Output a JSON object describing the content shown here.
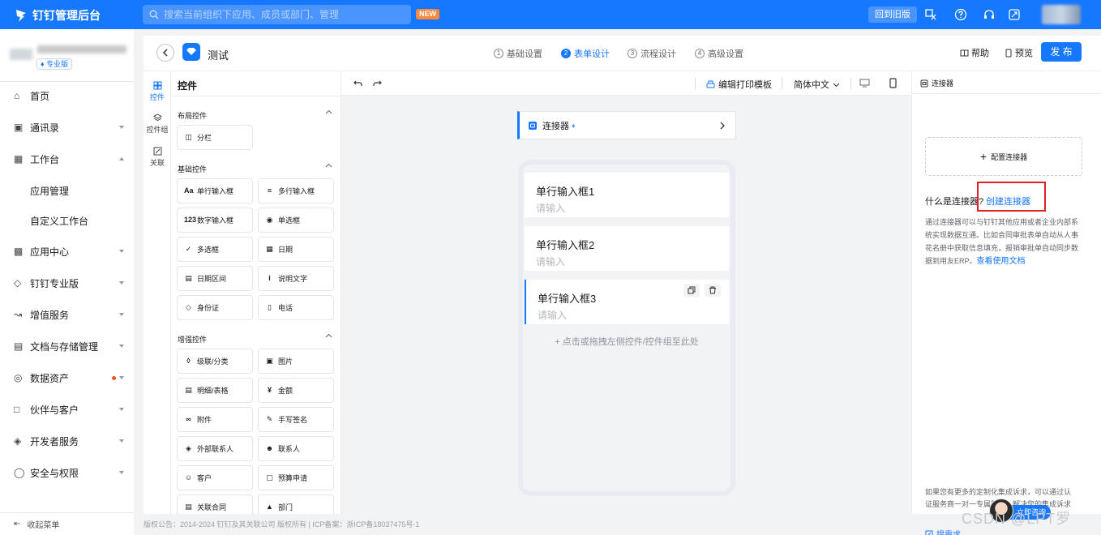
{
  "topbar": {
    "brand": "钉钉管理后台",
    "search_placeholder": "搜索当前组织下应用、成员或部门、管理",
    "new_badge": "NEW",
    "old_version": "回到旧版"
  },
  "sidebar": {
    "plan_badge": "专业版",
    "items": [
      {
        "label": "首页",
        "icon": "home-icon",
        "arrow": ""
      },
      {
        "label": "通讯录",
        "icon": "contacts-icon",
        "arrow": "down"
      },
      {
        "label": "工作台",
        "icon": "workbench-icon",
        "arrow": "up"
      },
      {
        "label": "应用管理",
        "icon": "",
        "arrow": ""
      },
      {
        "label": "自定义工作台",
        "icon": "",
        "arrow": ""
      },
      {
        "label": "应用中心",
        "icon": "app-center-icon",
        "arrow": "down"
      },
      {
        "label": "钉钉专业版",
        "icon": "diamond-icon",
        "arrow": "down"
      },
      {
        "label": "增值服务",
        "icon": "chart-icon",
        "arrow": "down"
      },
      {
        "label": "文档与存储管理",
        "icon": "storage-icon",
        "arrow": "down"
      },
      {
        "label": "数据资产",
        "icon": "data-icon",
        "arrow": "down"
      },
      {
        "label": "伙伴与客户",
        "icon": "partner-icon",
        "arrow": "down"
      },
      {
        "label": "开发者服务",
        "icon": "layers-icon",
        "arrow": "down"
      },
      {
        "label": "安全与权限",
        "icon": "shield-icon",
        "arrow": "down"
      }
    ],
    "collapse": "收起菜单"
  },
  "header": {
    "title": "测试",
    "steps": [
      {
        "num": "1",
        "label": "基础设置",
        "active": false
      },
      {
        "num": "2",
        "label": "表单设计",
        "active": true
      },
      {
        "num": "3",
        "label": "流程设计",
        "active": false
      },
      {
        "num": "4",
        "label": "高级设置",
        "active": false
      }
    ],
    "help": "帮助",
    "preview": "预览",
    "publish": "发 布"
  },
  "tabs": [
    {
      "label": "控件"
    },
    {
      "label": "控件组"
    },
    {
      "label": "关联"
    }
  ],
  "controls": {
    "title": "控件",
    "groups": [
      {
        "title": "布局控件",
        "items": [
          {
            "label": "分栏",
            "icon": "columns-icon"
          }
        ]
      },
      {
        "title": "基础控件",
        "items": [
          {
            "label": "单行输入框",
            "icon": "text-input-icon"
          },
          {
            "label": "多行输入框",
            "icon": "textarea-icon"
          },
          {
            "label": "数字输入框",
            "icon": "number-icon"
          },
          {
            "label": "单选框",
            "icon": "radio-icon"
          },
          {
            "label": "多选框",
            "icon": "checkbox-icon"
          },
          {
            "label": "日期",
            "icon": "date-icon"
          },
          {
            "label": "日期区间",
            "icon": "date-range-icon"
          },
          {
            "label": "说明文字",
            "icon": "info-icon"
          },
          {
            "label": "身份证",
            "icon": "id-card-icon"
          },
          {
            "label": "电话",
            "icon": "phone-icon"
          }
        ]
      },
      {
        "title": "增强控件",
        "items": [
          {
            "label": "级联/分类",
            "icon": "cascade-icon"
          },
          {
            "label": "图片",
            "icon": "image-icon"
          },
          {
            "label": "明细/表格",
            "icon": "table-icon"
          },
          {
            "label": "金额",
            "icon": "money-icon"
          },
          {
            "label": "附件",
            "icon": "attachment-icon"
          },
          {
            "label": "手写签名",
            "icon": "signature-icon"
          },
          {
            "label": "外部联系人",
            "icon": "external-contact-icon"
          },
          {
            "label": "联系人",
            "icon": "contact-icon"
          },
          {
            "label": "客户",
            "icon": "customer-icon"
          },
          {
            "label": "预算申请",
            "icon": "budget-icon"
          },
          {
            "label": "关联合同",
            "icon": "contract-icon"
          },
          {
            "label": "部门",
            "icon": "department-icon"
          }
        ]
      }
    ]
  },
  "canvas": {
    "print_template": "编辑打印模板",
    "language": "简体中文",
    "connector": "连接器",
    "fields": [
      {
        "label": "单行输入框1",
        "placeholder": "请输入"
      },
      {
        "label": "单行输入框2",
        "placeholder": "请输入"
      },
      {
        "label": "单行输入框3",
        "placeholder": "请输入"
      }
    ],
    "drop_hint": "点击或拖拽左侧控件/控件组至此处"
  },
  "right": {
    "title": "连接器",
    "config": "配置连接器",
    "what": "什么是连接器?",
    "create": "创建连接器",
    "desc": "通过连接器可以与钉钉其他应用或者企业内部系统实现数据互通。比如合同审批表单自动从人事花名册中获取信息填充，报销审批单自动同步数据到用友ERP。",
    "doc_link": "查看使用文档",
    "bottom": "如果您有更多的定制化集成诉求，可以通过认证服务商一对一专属服务，解决您的集成诉求",
    "request": "提需求",
    "consult": "立即咨询"
  },
  "footer": "版权公告：2014-2024 钉钉及其关联公司 版权所有 | ICP备案：浙ICP备18037475号-1",
  "watermark": "CSDN @LPT罗"
}
